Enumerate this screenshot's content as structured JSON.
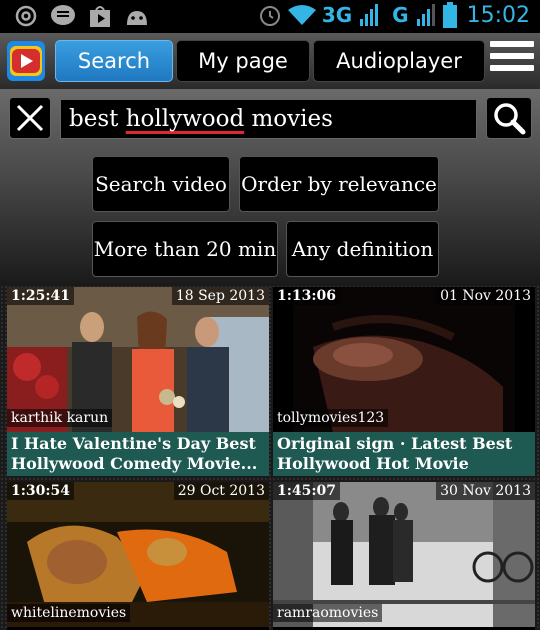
{
  "status_bar": {
    "icons": [
      "at-icon",
      "message-icon",
      "play-store-icon",
      "android-icon",
      "alarm-icon",
      "wifi-icon",
      "signal-icon",
      "battery-icon"
    ],
    "network_1": "3G",
    "network_2": "G",
    "time": "15:02"
  },
  "nav": {
    "tabs": [
      {
        "label": "Search",
        "active": true
      },
      {
        "label": "My page",
        "active": false
      },
      {
        "label": "Audioplayer",
        "active": false
      }
    ]
  },
  "search": {
    "query_before": "best ",
    "query_highlight": "hollywood",
    "query_after": " movies",
    "options": [
      "Search video",
      "Order by relevance",
      "More than 20 min",
      "Any definition"
    ]
  },
  "results": [
    {
      "duration": "1:25:41",
      "date": "18 Sep 2013",
      "channel": "karthik karun",
      "title": "I Hate Valentine's Day Best Hollywood Comedy Movie..."
    },
    {
      "duration": "1:13:06",
      "date": "01 Nov 2013",
      "channel": "tollymovies123",
      "title": "Original sign · Latest Best Hollywood Hot Movie"
    },
    {
      "duration": "1:30:54",
      "date": "29 Oct 2013",
      "channel": "whitelinemovies",
      "title": ""
    },
    {
      "duration": "1:45:07",
      "date": "30 Nov 2013",
      "channel": "ramraomovies",
      "title": ""
    }
  ],
  "colors": {
    "accent": "#33b5e5",
    "active_tab": "#2a8ad4",
    "title_bar": "#1f5a52",
    "spell_underline": "#e0262e"
  }
}
